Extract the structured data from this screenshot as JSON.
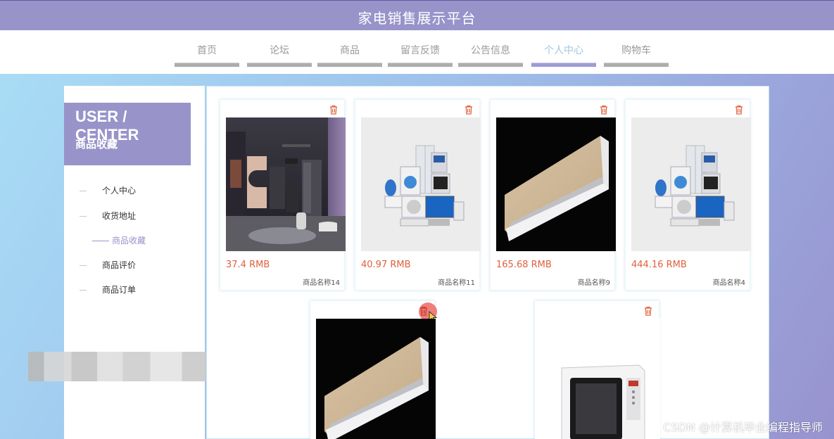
{
  "header": {
    "title": "家电销售展示平台"
  },
  "nav": {
    "items": [
      {
        "label": "首页"
      },
      {
        "label": "论坛"
      },
      {
        "label": "商品"
      },
      {
        "label": "留言反馈"
      },
      {
        "label": "公告信息"
      },
      {
        "label": "个人中心",
        "active": true
      },
      {
        "label": "购物车"
      }
    ]
  },
  "sidebar": {
    "title": "USER / CENTER",
    "subtitle": "商品收藏",
    "menu": [
      {
        "label": "个人中心"
      },
      {
        "label": "收货地址"
      },
      {
        "label": "商品收藏",
        "active": true
      },
      {
        "label": "商品评价"
      },
      {
        "label": "商品订单"
      }
    ]
  },
  "favorites": [
    {
      "price": "37.4 RMB",
      "name": "商品名称14",
      "image": "kitchen-appliance-room"
    },
    {
      "price": "40.97 RMB",
      "name": "商品名称11",
      "image": "appliance-collage"
    },
    {
      "price": "165.68 RMB",
      "name": "商品名称9",
      "image": "air-conditioner"
    },
    {
      "price": "444.16 RMB",
      "name": "商品名称4",
      "image": "appliance-collage"
    },
    {
      "price": "",
      "name": "",
      "image": "air-conditioner"
    },
    {
      "price": "",
      "name": "",
      "image": "microwave-oven"
    }
  ],
  "colors": {
    "accent": "#9893c9",
    "price": "#e0603d",
    "trash": "#e0603d"
  },
  "watermark": "CSDN @计算机毕业编程指导师"
}
